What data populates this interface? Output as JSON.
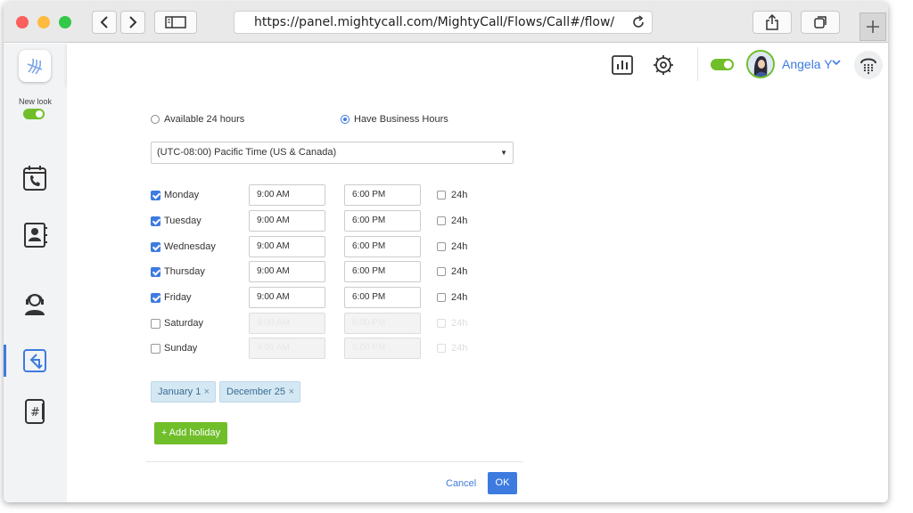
{
  "browser": {
    "url": "https://panel.mightycall.com/MightyCall/Flows/Call#/flow/"
  },
  "sidebar": {
    "new_look_label": "New look",
    "new_look_enabled": true,
    "items": [
      {
        "name": "calls",
        "icon": "phone-calendar-icon"
      },
      {
        "name": "contacts",
        "icon": "contacts-book-icon"
      },
      {
        "name": "agent",
        "icon": "headset-agent-icon"
      },
      {
        "name": "flows",
        "icon": "call-flow-icon",
        "active": true
      },
      {
        "name": "numbers",
        "icon": "phone-number-icon"
      }
    ]
  },
  "header": {
    "user_name": "Angela Y",
    "status_online": true,
    "icons": [
      "reports-icon",
      "settings-gear-icon",
      "dialpad-icon"
    ]
  },
  "hours": {
    "option_24": "Available 24 hours",
    "option_business": "Have Business Hours",
    "selected": "business",
    "timezone": "(UTC-08:00) Pacific Time (US & Canada)",
    "days": [
      {
        "name": "Monday",
        "checked": true,
        "start": "9:00 AM",
        "end": "6:00 PM",
        "label_24": "24h"
      },
      {
        "name": "Tuesday",
        "checked": true,
        "start": "9:00 AM",
        "end": "6:00 PM",
        "label_24": "24h"
      },
      {
        "name": "Wednesday",
        "checked": true,
        "start": "9:00 AM",
        "end": "6:00 PM",
        "label_24": "24h"
      },
      {
        "name": "Thursday",
        "checked": true,
        "start": "9:00 AM",
        "end": "6:00 PM",
        "label_24": "24h"
      },
      {
        "name": "Friday",
        "checked": true,
        "start": "9:00 AM",
        "end": "6:00 PM",
        "label_24": "24h"
      },
      {
        "name": "Saturday",
        "checked": false,
        "start": "9:00 AM",
        "end": "6:00 PM",
        "label_24": "24h"
      },
      {
        "name": "Sunday",
        "checked": false,
        "start": "9:00 AM",
        "end": "6:00 PM",
        "label_24": "24h"
      }
    ]
  },
  "holidays": {
    "items": [
      "January 1",
      "December 25"
    ],
    "remove_glyph": "×",
    "add_label": "+ Add holiday"
  },
  "footer": {
    "cancel_label": "Cancel",
    "ok_label": "OK"
  },
  "colors": {
    "accent": "#3d7be0",
    "success": "#6fbe2a",
    "chip_bg": "#d3e8f2"
  }
}
